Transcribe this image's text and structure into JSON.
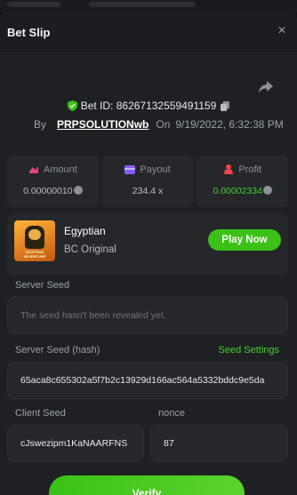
{
  "header": {
    "title": "Bet Slip",
    "close_label": "×"
  },
  "bet": {
    "id_prefix": "Bet ID:",
    "id": "86267132559491159",
    "by_label": "By",
    "user": "PRPSOLUTIONwb",
    "on_label": "On",
    "datetime": "9/19/2022, 6:32:38 PM"
  },
  "stats": {
    "amount": {
      "label": "Amount",
      "value": "0.00000010"
    },
    "payout": {
      "label": "Payout",
      "value": "234.4 x"
    },
    "profit": {
      "label": "Profit",
      "value": "0.00002334"
    }
  },
  "game": {
    "name": "Egyptian",
    "provider": "BC Original",
    "thumb_caption": "EGYPTIAN ADVENTURE",
    "play_label": "Play Now"
  },
  "server_seed": {
    "label": "Server Seed",
    "placeholder": "The seed hasn't been revealed yet."
  },
  "server_seed_hash": {
    "label": "Server Seed (hash)",
    "settings_link": "Seed Settings",
    "value": "65aca8c655302a5f7b2c13929d166ac564a5332bddc9e5da"
  },
  "client_seed": {
    "label": "Client Seed",
    "value": "cJswezipm1KaNAARFNS"
  },
  "nonce": {
    "label": "nonce",
    "value": "87"
  },
  "verify": {
    "label": "Verify"
  },
  "colors": {
    "accent": "#3bc117",
    "profit": "#43d12a",
    "panel": "#25272b",
    "modal": "#1e2023"
  }
}
